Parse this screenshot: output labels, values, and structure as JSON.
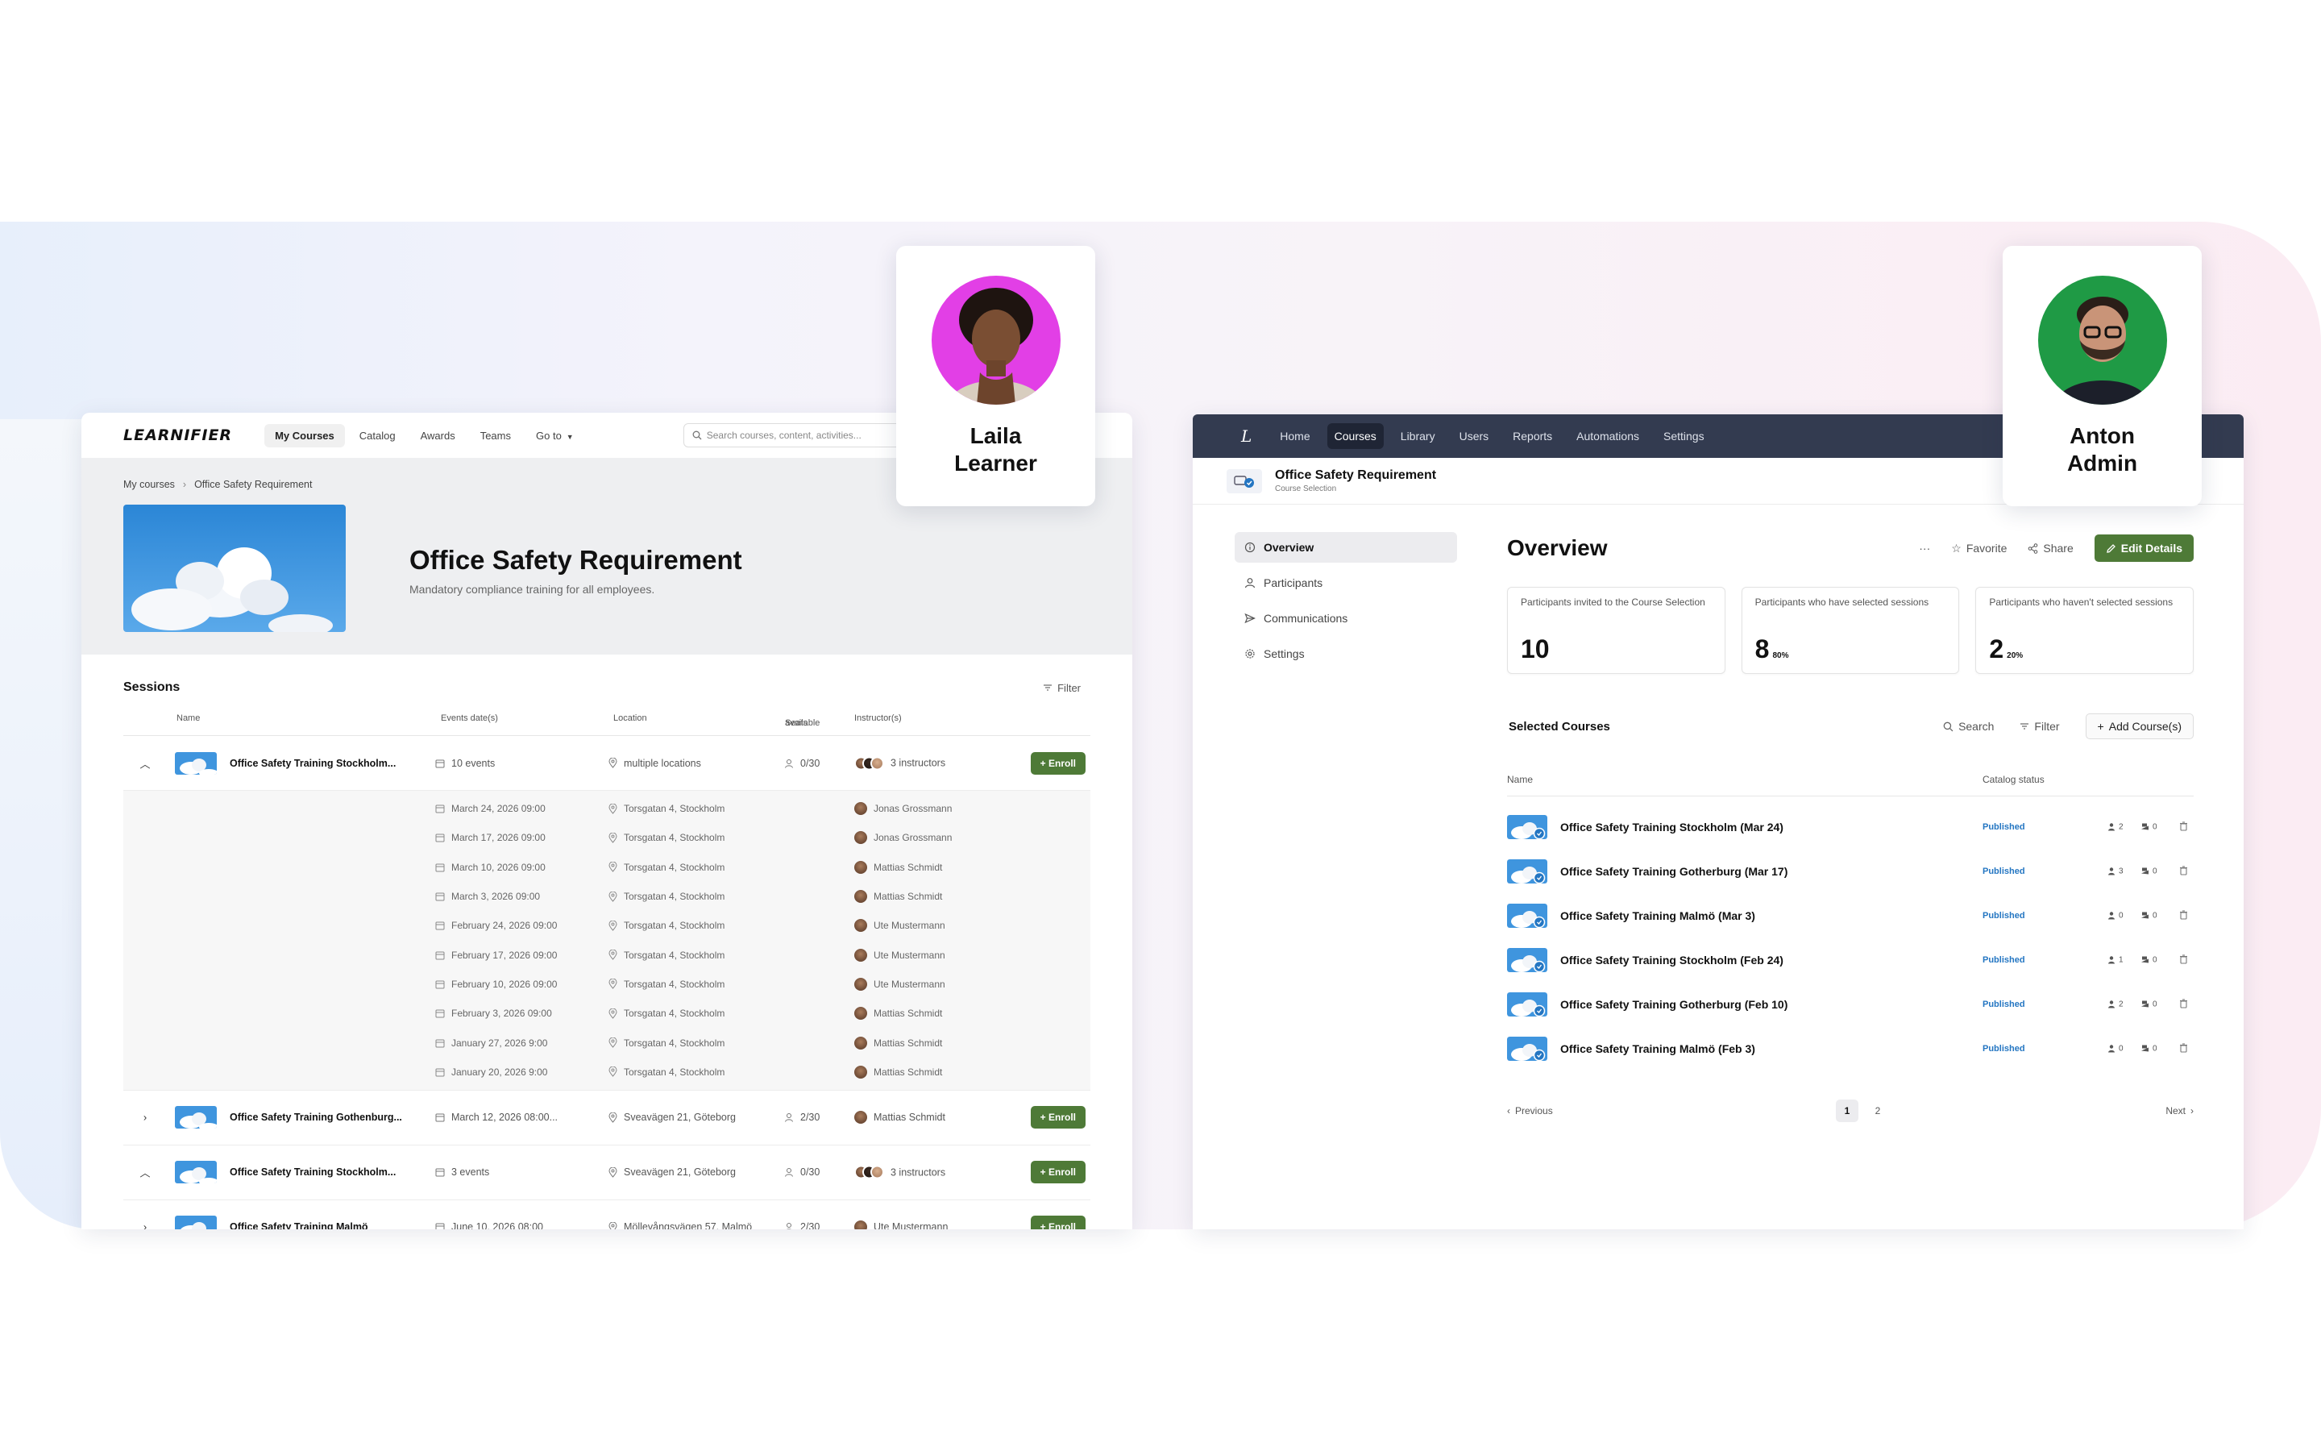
{
  "learner_persona": {
    "first": "Laila",
    "last": "Learner"
  },
  "admin_persona": {
    "first": "Anton",
    "last": "Admin"
  },
  "learner": {
    "logo": "LEARNIFIER",
    "nav": [
      "My Courses",
      "Catalog",
      "Awards",
      "Teams",
      "Go to"
    ],
    "search_placeholder": "Search courses, content, activities...",
    "breadcrumb": [
      "My courses",
      "Office Safety Requirement"
    ],
    "title": "Office Safety Requirement",
    "subtitle": "Mandatory compliance training for all employees.",
    "sessions_title": "Sessions",
    "filter_label": "Filter",
    "columns": {
      "name": "Name",
      "dates": "Events date(s)",
      "location": "Location",
      "seats_line1": "Seats",
      "seats_line2": "available",
      "instructors": "Instructor(s)"
    },
    "enroll_label": "Enroll",
    "sessions": [
      {
        "name": "Office Safety Training Stockholm...",
        "events": "10 events",
        "location": "multiple locations",
        "seats": "0/30",
        "instructors": "3 instructors",
        "expanded": true
      },
      {
        "name": "Office Safety Training Gothenburg...",
        "events": "March 12, 2026 08:00...",
        "location": "Sveavägen 21, Göteborg",
        "seats": "2/30",
        "instructors": "Mattias Schmidt",
        "expanded": false
      },
      {
        "name": "Office Safety Training Stockholm...",
        "events": "3 events",
        "location": "Sveavägen 21, Göteborg",
        "seats": "0/30",
        "instructors": "3 instructors",
        "expanded": true
      },
      {
        "name": "Office Safety Training Malmö",
        "events": "June 10, 2026 08:00",
        "location": "Möllevångsvägen 57, Malmö",
        "seats": "2/30",
        "instructors": "Ute Mustermann",
        "expanded": false
      }
    ],
    "sub_events": [
      {
        "date": "March 24, 2026 09:00",
        "location": "Torsgatan 4, Stockholm",
        "instructor": "Jonas Grossmann"
      },
      {
        "date": "March 17, 2026 09:00",
        "location": "Torsgatan 4, Stockholm",
        "instructor": "Jonas Grossmann"
      },
      {
        "date": "March 10, 2026 09:00",
        "location": "Torsgatan 4, Stockholm",
        "instructor": "Mattias Schmidt"
      },
      {
        "date": "March 3, 2026 09:00",
        "location": "Torsgatan 4, Stockholm",
        "instructor": "Mattias Schmidt"
      },
      {
        "date": "February 24, 2026 09:00",
        "location": "Torsgatan 4, Stockholm",
        "instructor": "Ute Mustermann"
      },
      {
        "date": "February 17, 2026 09:00",
        "location": "Torsgatan 4, Stockholm",
        "instructor": "Ute Mustermann"
      },
      {
        "date": "February 10, 2026 09:00",
        "location": "Torsgatan 4, Stockholm",
        "instructor": "Ute Mustermann"
      },
      {
        "date": "February 3, 2026 09:00",
        "location": "Torsgatan 4, Stockholm",
        "instructor": "Mattias Schmidt"
      },
      {
        "date": "January 27, 2026 9:00",
        "location": "Torsgatan 4, Stockholm",
        "instructor": "Mattias Schmidt"
      },
      {
        "date": "January 20, 2026 9:00",
        "location": "Torsgatan 4, Stockholm",
        "instructor": "Mattias Schmidt"
      }
    ]
  },
  "admin": {
    "logo": "L",
    "nav": [
      "Home",
      "Courses",
      "Library",
      "Users",
      "Reports",
      "Automations",
      "Settings"
    ],
    "active_nav": "Courses",
    "course_title": "Office Safety Requirement",
    "course_caption": "Course Selection",
    "sidebar": [
      "Overview",
      "Participants",
      "Communications",
      "Settings"
    ],
    "overview_title": "Overview",
    "more_label": "···",
    "favorite_label": "Favorite",
    "share_label": "Share",
    "edit_label": "Edit Details",
    "stats": [
      {
        "label": "Participants invited to the Course Selection",
        "value": "10",
        "pct": ""
      },
      {
        "label": "Participants who have selected sessions",
        "value": "8",
        "pct": "80%"
      },
      {
        "label": "Participants who haven't selected sessions",
        "value": "2",
        "pct": "20%"
      }
    ],
    "selected_title": "Selected Courses",
    "search_label": "Search",
    "filter_label": "Filter",
    "add_label": "Add Course(s)",
    "col_name": "Name",
    "col_status": "Catalog status",
    "courses": [
      {
        "name": "Office Safety Training Stockholm (Mar 24)",
        "status": "Published",
        "users": "2",
        "seats": "0"
      },
      {
        "name": "Office Safety Training Gotherburg (Mar 17)",
        "status": "Published",
        "users": "3",
        "seats": "0"
      },
      {
        "name": "Office Safety Training Malmö (Mar 3)",
        "status": "Published",
        "users": "0",
        "seats": "0"
      },
      {
        "name": "Office Safety Training Stockholm (Feb 24)",
        "status": "Published",
        "users": "1",
        "seats": "0"
      },
      {
        "name": "Office Safety Training Gotherburg (Feb 10)",
        "status": "Published",
        "users": "2",
        "seats": "0"
      },
      {
        "name": "Office Safety Training Malmö (Feb 3)",
        "status": "Published",
        "users": "0",
        "seats": "0"
      }
    ],
    "pager": {
      "prev": "Previous",
      "next": "Next",
      "pages": [
        "1",
        "2"
      ]
    }
  },
  "colors": {
    "accent_green": "#4e7a37",
    "admin_nav": "#333b50",
    "published_blue": "#2476c2",
    "laila_bg": "#e23fe6",
    "anton_bg": "#1f9a45"
  }
}
